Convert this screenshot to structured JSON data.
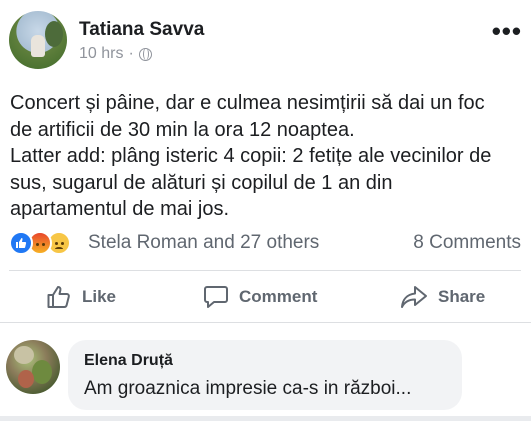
{
  "post": {
    "author": "Tatiana Savva",
    "time": "10 hrs",
    "separator": "·",
    "privacy_icon": "globe-icon",
    "more_icon": "ellipsis-icon",
    "more_label": "•••",
    "text_lines": [
      "Concert și pâine, dar e culmea nesimțirii să dai un foc",
      "de artificii de 30 min la ora 12 noaptea.",
      "Latter add: plâng isteric 4 copii: 2 fetițe ale vecinilor de",
      "sus, sugarul de alături și copilul de 1 an din",
      "apartamentul de mai jos."
    ]
  },
  "reactions": {
    "icons": [
      "like-icon",
      "angry-icon",
      "sad-icon"
    ],
    "names": "Stela Roman and 27 others",
    "comments_count": "8 Comments"
  },
  "actions": {
    "like": "Like",
    "comment": "Comment",
    "share": "Share"
  },
  "comment": {
    "author": "Elena Druță",
    "text": "Am groaznica impresie ca-s in război..."
  },
  "colors": {
    "like_blue": "#2078f4",
    "text_primary": "#1c1e21",
    "text_secondary": "#606770",
    "bubble_bg": "#f2f3f5"
  }
}
